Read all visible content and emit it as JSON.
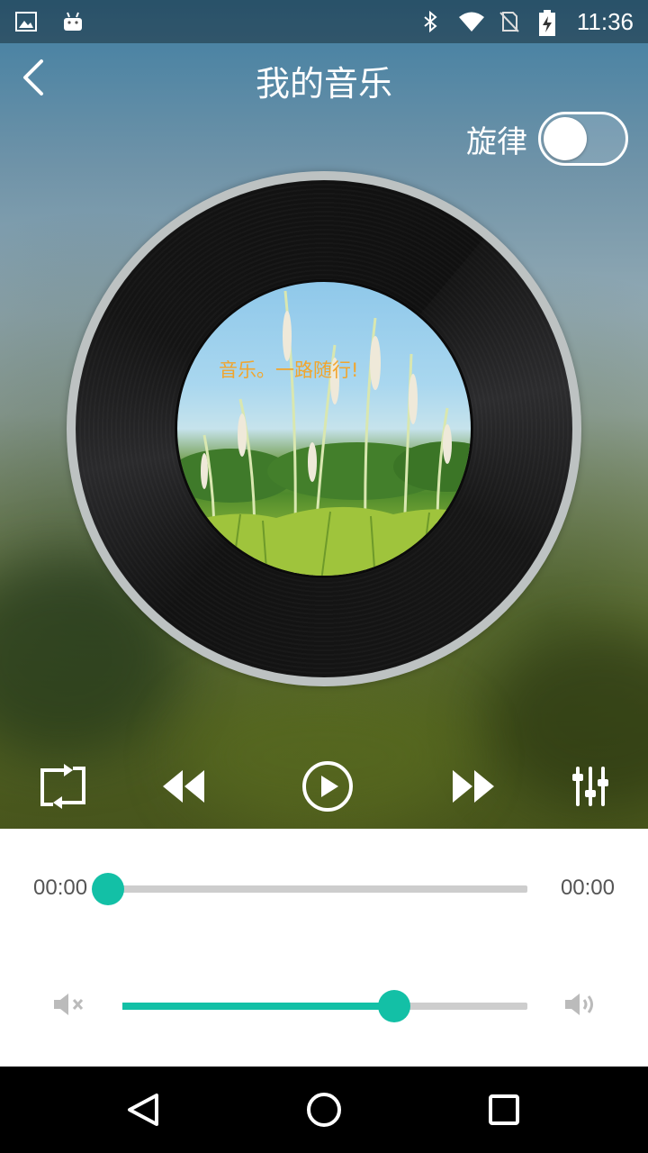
{
  "status_bar": {
    "time": "11:36",
    "left_icons": [
      "gallery-icon",
      "android-icon"
    ],
    "right_icons": [
      "bluetooth-icon",
      "wifi-icon",
      "no-sim-icon",
      "battery-charging-icon"
    ]
  },
  "header": {
    "title": "我的音乐",
    "back_icon": "chevron-left-icon"
  },
  "rotate_toggle": {
    "label": "旋律",
    "state": "off"
  },
  "disc": {
    "caption": "音乐。一路随行!"
  },
  "controls": {
    "repeat_icon": "repeat-icon",
    "rewind_icon": "rewind-icon",
    "play_icon": "play-circle-icon",
    "forward_icon": "fast-forward-icon",
    "equalizer_icon": "equalizer-icon"
  },
  "progress": {
    "current": "00:00",
    "total": "00:00",
    "value": 0
  },
  "volume": {
    "value": 0.67,
    "mute_icon": "volume-mute-icon",
    "max_icon": "volume-up-icon"
  },
  "nav_bar": {
    "buttons": [
      "back-triangle-icon",
      "home-circle-icon",
      "recents-square-icon"
    ]
  },
  "colors": {
    "accent": "#13c0a6",
    "caption": "#f2a52c",
    "panel_bg": "#ffffff",
    "track_bg": "#cdcdcd"
  }
}
